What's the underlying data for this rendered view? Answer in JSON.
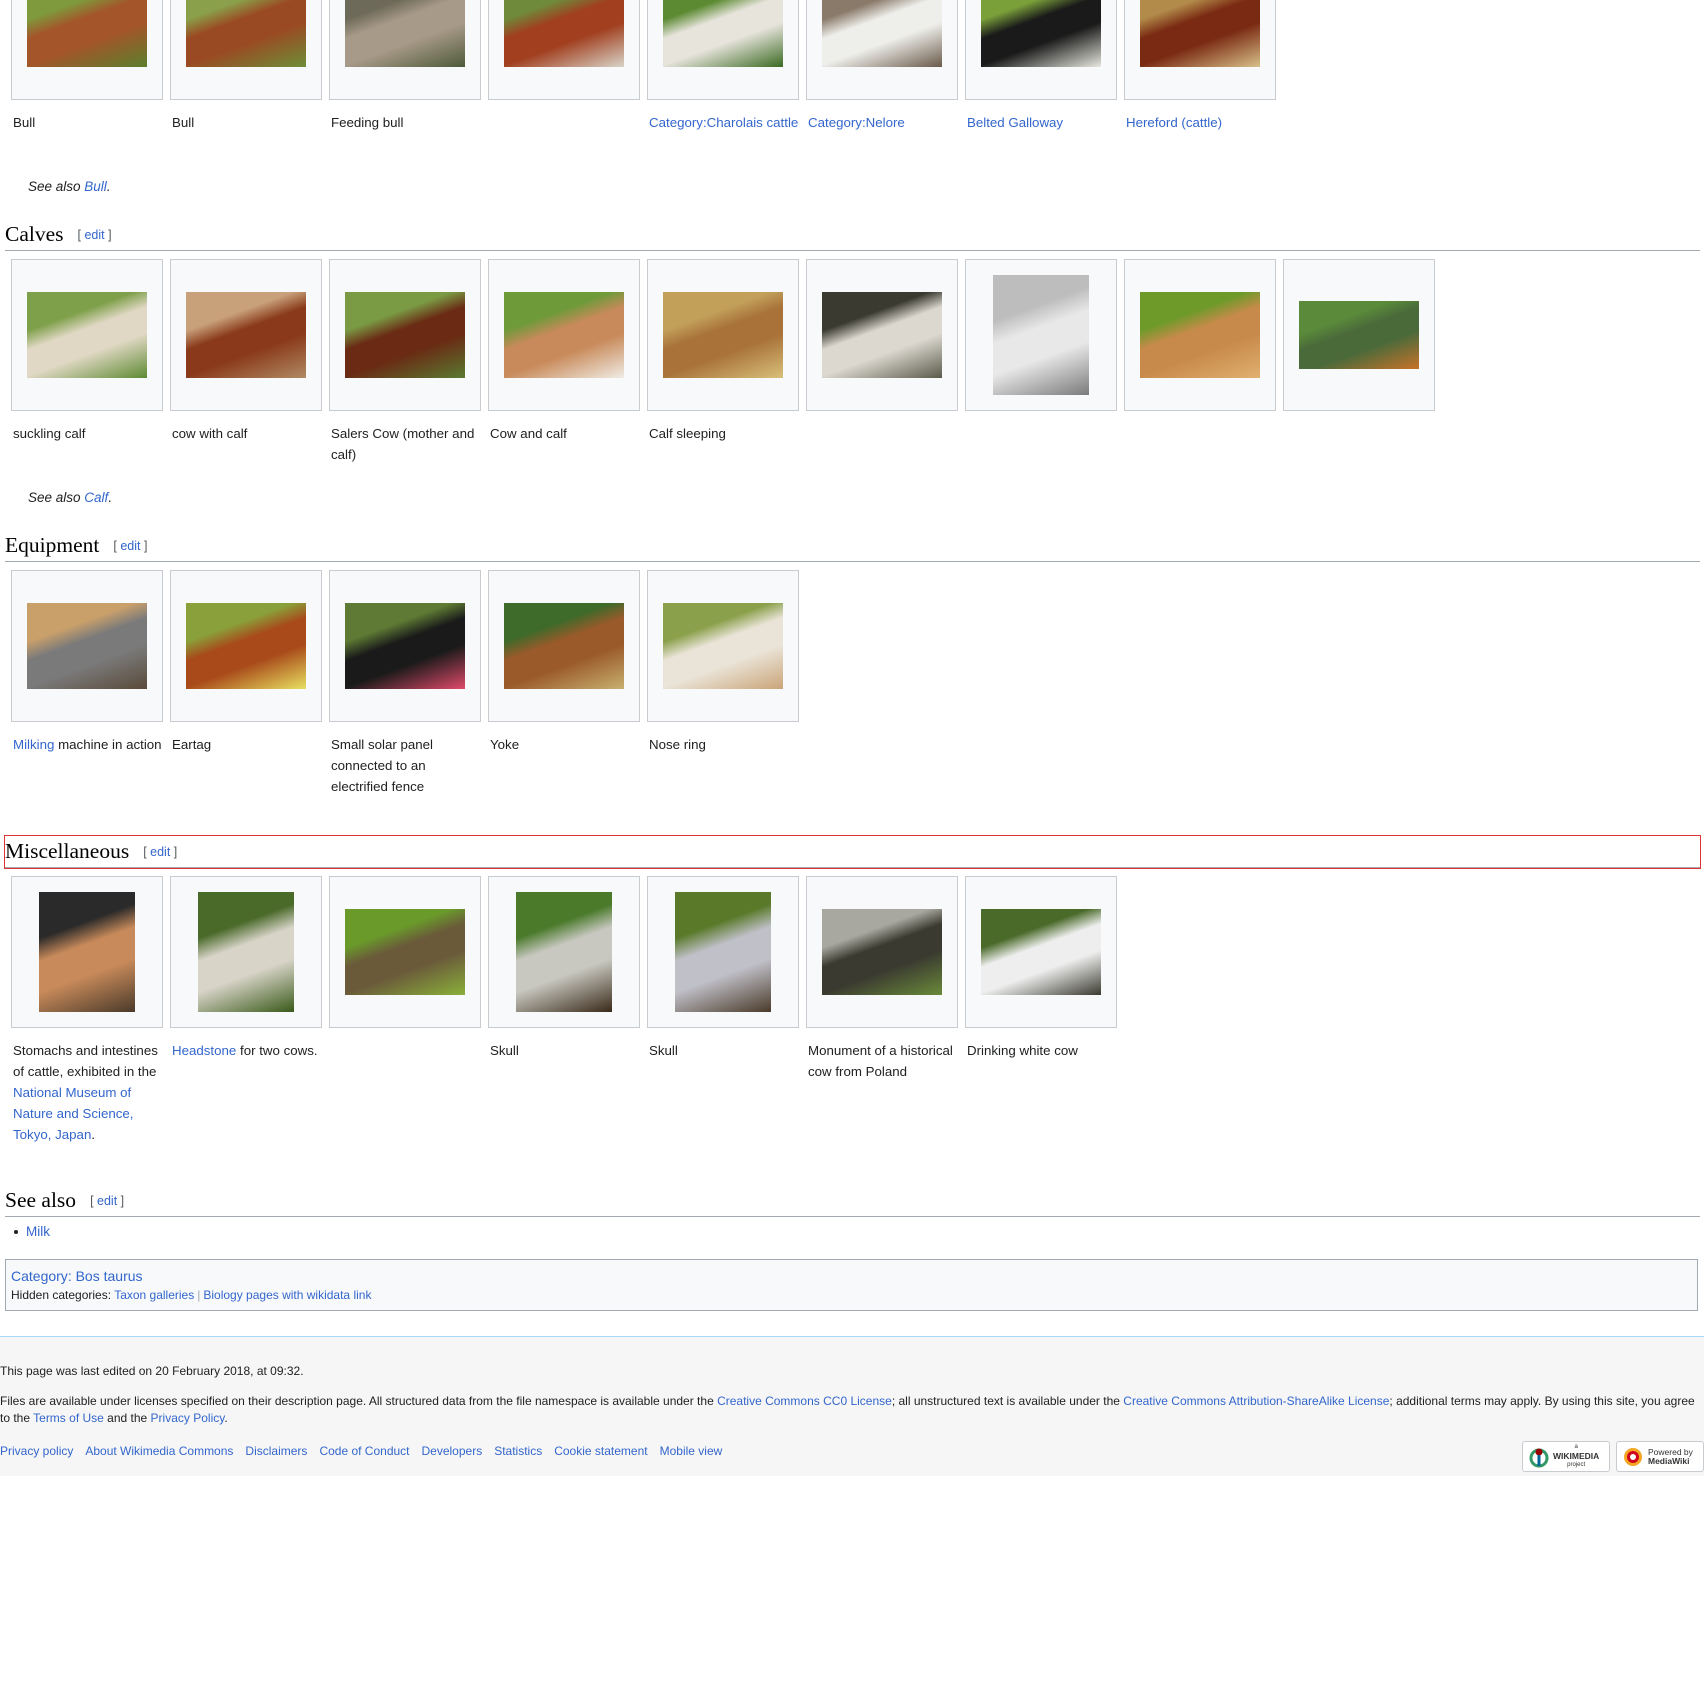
{
  "top_gallery": [
    {
      "caption": "Bull",
      "caption_link": false,
      "colors": [
        "#7e9a3c",
        "#a4552a",
        "#5c7f2c"
      ]
    },
    {
      "caption": "Bull",
      "caption_link": false,
      "colors": [
        "#8aa04a",
        "#9a4a22",
        "#6e8e38"
      ]
    },
    {
      "caption": "Feeding bull",
      "caption_link": false,
      "colors": [
        "#6e6a5a",
        "#a89a88",
        "#4e5a3a"
      ]
    },
    {
      "caption": "",
      "caption_link": false,
      "colors": [
        "#6f8a3a",
        "#a13f1f",
        "#d8d4c8"
      ]
    },
    {
      "caption": "Category:Charolais cattle",
      "caption_link": true,
      "colors": [
        "#5b8a32",
        "#e7e4dc",
        "#3b6a22"
      ]
    },
    {
      "caption": "Category:Nelore",
      "caption_link": true,
      "colors": [
        "#8a7a6a",
        "#eeeeea",
        "#6a5a4a"
      ]
    },
    {
      "caption": "Belted Galloway",
      "caption_link": true,
      "colors": [
        "#7aa03a",
        "#1a1a1a",
        "#e8e8e0"
      ]
    },
    {
      "caption": "Hereford (cattle)",
      "caption_link": true,
      "colors": [
        "#b28a4a",
        "#7a2a12",
        "#d8c08a"
      ]
    }
  ],
  "see_also_bull": {
    "prefix": "See also ",
    "link": "Bull",
    "suffix": "."
  },
  "sections": {
    "calves": {
      "title": "Calves",
      "edit": "edit"
    },
    "equipment": {
      "title": "Equipment",
      "edit": "edit"
    },
    "misc": {
      "title": "Miscellaneous",
      "edit": "edit"
    },
    "see_also": {
      "title": "See also",
      "edit": "edit"
    }
  },
  "edit_bracket_open": "[ ",
  "edit_bracket_close": " ]",
  "calves_gallery": [
    {
      "caption": "suckling calf",
      "colors": [
        "#7fa04a",
        "#e0d8c4",
        "#5e8a32"
      ],
      "shape": "land"
    },
    {
      "caption": "cow with calf",
      "colors": [
        "#c8a07a",
        "#8a3a1a",
        "#b08a64"
      ],
      "shape": "land"
    },
    {
      "caption": "Salers Cow (mother and calf)",
      "colors": [
        "#7a9a44",
        "#6a2a14",
        "#5a7a30"
      ],
      "shape": "land"
    },
    {
      "caption": "Cow and calf",
      "colors": [
        "#6e9a3a",
        "#c88a5a",
        "#f0ece4"
      ],
      "shape": "land"
    },
    {
      "caption": "Calf sleeping",
      "colors": [
        "#c2a05a",
        "#a87238",
        "#d8c07a"
      ],
      "shape": "land"
    },
    {
      "caption": "",
      "colors": [
        "#3a3a30",
        "#dcd8d0",
        "#5a5a4a"
      ],
      "shape": "land"
    },
    {
      "caption": "",
      "colors": [
        "#bdbdbd",
        "#e8e8e8",
        "#7a7a7a"
      ],
      "shape": "portrait"
    },
    {
      "caption": "",
      "colors": [
        "#6e9a2a",
        "#c88a4a",
        "#e0b070"
      ],
      "shape": "land"
    },
    {
      "caption": "",
      "colors": [
        "#5a8a3a",
        "#4a6a3a",
        "#c8722a"
      ],
      "shape": "wide"
    }
  ],
  "see_also_calf": {
    "prefix": "See also ",
    "link": "Calf",
    "suffix": "."
  },
  "equipment_gallery": [
    {
      "caption_link": "Milking",
      "caption_rest": " machine in action",
      "colors": [
        "#caa06a",
        "#7a7a7a",
        "#5a4a3a"
      ]
    },
    {
      "caption_link": "",
      "caption_rest": "Eartag",
      "colors": [
        "#8aa03a",
        "#a84a1a",
        "#e8e060"
      ]
    },
    {
      "caption_link": "",
      "caption_rest": "Small solar panel connected to an electrified fence",
      "colors": [
        "#5e7a34",
        "#1a1a1a",
        "#e04a6a"
      ]
    },
    {
      "caption_link": "",
      "caption_rest": "Yoke",
      "colors": [
        "#3e6a2a",
        "#9a5a2a",
        "#c8b070"
      ]
    },
    {
      "caption_link": "",
      "caption_rest": "Nose ring",
      "colors": [
        "#8aa04a",
        "#eae4d8",
        "#caa478"
      ]
    }
  ],
  "misc_gallery": [
    {
      "parts": [
        {
          "t": "Stomachs and intestines of cattle, exhibited in the ",
          "l": false
        },
        {
          "t": "National Museum of Nature and Science, Tokyo, Japan",
          "l": true
        },
        {
          "t": ".",
          "l": false
        }
      ],
      "colors": [
        "#2a2a2a",
        "#c88a5a",
        "#4a3a2a"
      ],
      "shape": "portrait"
    },
    {
      "parts": [
        {
          "t": "Headstone",
          "l": true
        },
        {
          "t": " for two cows.",
          "l": false
        }
      ],
      "colors": [
        "#4a6a2a",
        "#d8d4c8",
        "#3a5a1a"
      ],
      "shape": "portrait"
    },
    {
      "parts": [],
      "colors": [
        "#6a9a2a",
        "#6a5a3a",
        "#8ab03a"
      ],
      "shape": "land"
    },
    {
      "parts": [
        {
          "t": "Skull",
          "l": false
        }
      ],
      "colors": [
        "#4a7a2a",
        "#c8c8c0",
        "#3a2a1a"
      ],
      "shape": "portrait"
    },
    {
      "parts": [
        {
          "t": "Skull",
          "l": false
        }
      ],
      "colors": [
        "#5a7a2a",
        "#c0c0c8",
        "#4a3a2a"
      ],
      "shape": "portrait"
    },
    {
      "parts": [
        {
          "t": "Monument of a historical cow from Poland",
          "l": false
        }
      ],
      "colors": [
        "#a8a8a0",
        "#3a3a30",
        "#6a8a3a"
      ],
      "shape": "land"
    },
    {
      "parts": [
        {
          "t": "Drinking white cow",
          "l": false
        }
      ],
      "colors": [
        "#4a6a2a",
        "#eeeeee",
        "#3a3a30"
      ],
      "shape": "land"
    }
  ],
  "see_also_list": [
    "Milk"
  ],
  "category": {
    "label": "Category",
    "name": "Bos taurus",
    "hidden_label": "Hidden categories: ",
    "hidden": [
      "Taxon galleries",
      "Biology pages with wikidata link"
    ]
  },
  "footer": {
    "last_edited": "This page was last edited on 20 February 2018, at 09:32.",
    "license_parts": [
      {
        "t": "Files are available under licenses specified on their description page. All structured data from the file namespace is available under the ",
        "l": false
      },
      {
        "t": "Creative Commons CC0 License",
        "l": true
      },
      {
        "t": "; all unstructured text is available under the ",
        "l": false
      },
      {
        "t": "Creative Commons Attribution-ShareAlike License",
        "l": true
      },
      {
        "t": "; additional terms may apply. By using this site, you agree to the ",
        "l": false
      },
      {
        "t": "Terms of Use",
        "l": true
      },
      {
        "t": " and the ",
        "l": false
      },
      {
        "t": "Privacy Policy",
        "l": true
      },
      {
        "t": ".",
        "l": false
      }
    ],
    "links": [
      "Privacy policy",
      "About Wikimedia Commons",
      "Disclaimers",
      "Code of Conduct",
      "Developers",
      "Statistics",
      "Cookie statement",
      "Mobile view"
    ],
    "badge_wikimedia": {
      "small": "a",
      "big": "WIKIMEDIA",
      "sub": "project"
    },
    "badge_mediawiki": {
      "line1": "Powered by",
      "line2": "MediaWiki"
    }
  }
}
